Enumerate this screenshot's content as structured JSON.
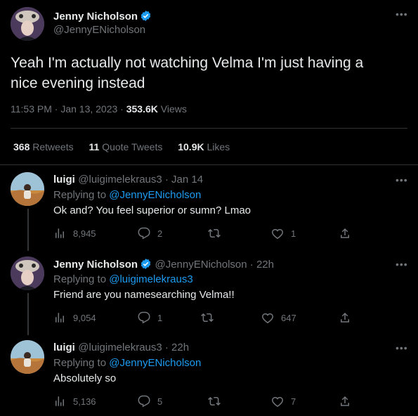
{
  "main": {
    "author": {
      "name": "Jenny Nicholson",
      "handle": "@JennyENicholson"
    },
    "text_line1": "Yeah I'm actually not watching Velma I'm just having a",
    "text_line2": "nice evening instead",
    "time": "11:53 PM · Jan 13, 2023 ·",
    "views_count": "353.6K",
    "views_label": "Views",
    "stats": {
      "retweets_count": "368",
      "retweets_label": "Retweets",
      "quotes_count": "11",
      "quotes_label": "Quote Tweets",
      "likes_count": "10.9K",
      "likes_label": "Likes"
    }
  },
  "replies": [
    {
      "name": "luigi",
      "handle": "@luigimelekraus3 · Jan 14",
      "replying_label": "Replying to",
      "replying_to": "@JennyENicholson",
      "text": "Ok and? You feel superior or sumn? Lmao",
      "views": "8,945",
      "replies": "2",
      "retweets": "",
      "likes": "1"
    },
    {
      "name": "Jenny Nicholson",
      "handle": "@JennyENicholson · 22h",
      "replying_label": "Replying to",
      "replying_to": "@luigimelekraus3",
      "text": "Friend are you namesearching Velma!!",
      "views": "9,054",
      "replies": "1",
      "retweets": "",
      "likes": "647"
    },
    {
      "name": "luigi",
      "handle": "@luigimelekraus3 · 22h",
      "replying_label": "Replying to",
      "replying_to": "@JennyENicholson",
      "text": "Absolutely so",
      "views": "5,136",
      "replies": "5",
      "retweets": "",
      "likes": "7"
    }
  ],
  "icons": {
    "verified": "verified-badge-icon",
    "more": "more-icon",
    "views": "views-icon",
    "reply": "reply-icon",
    "retweet": "retweet-icon",
    "like": "like-icon",
    "share": "share-icon"
  },
  "colors": {
    "background": "#000000",
    "text": "#e7e9ea",
    "muted": "#71767b",
    "link": "#1d9bf0",
    "verified": "#1d9bf0",
    "divider": "#2f3336"
  }
}
